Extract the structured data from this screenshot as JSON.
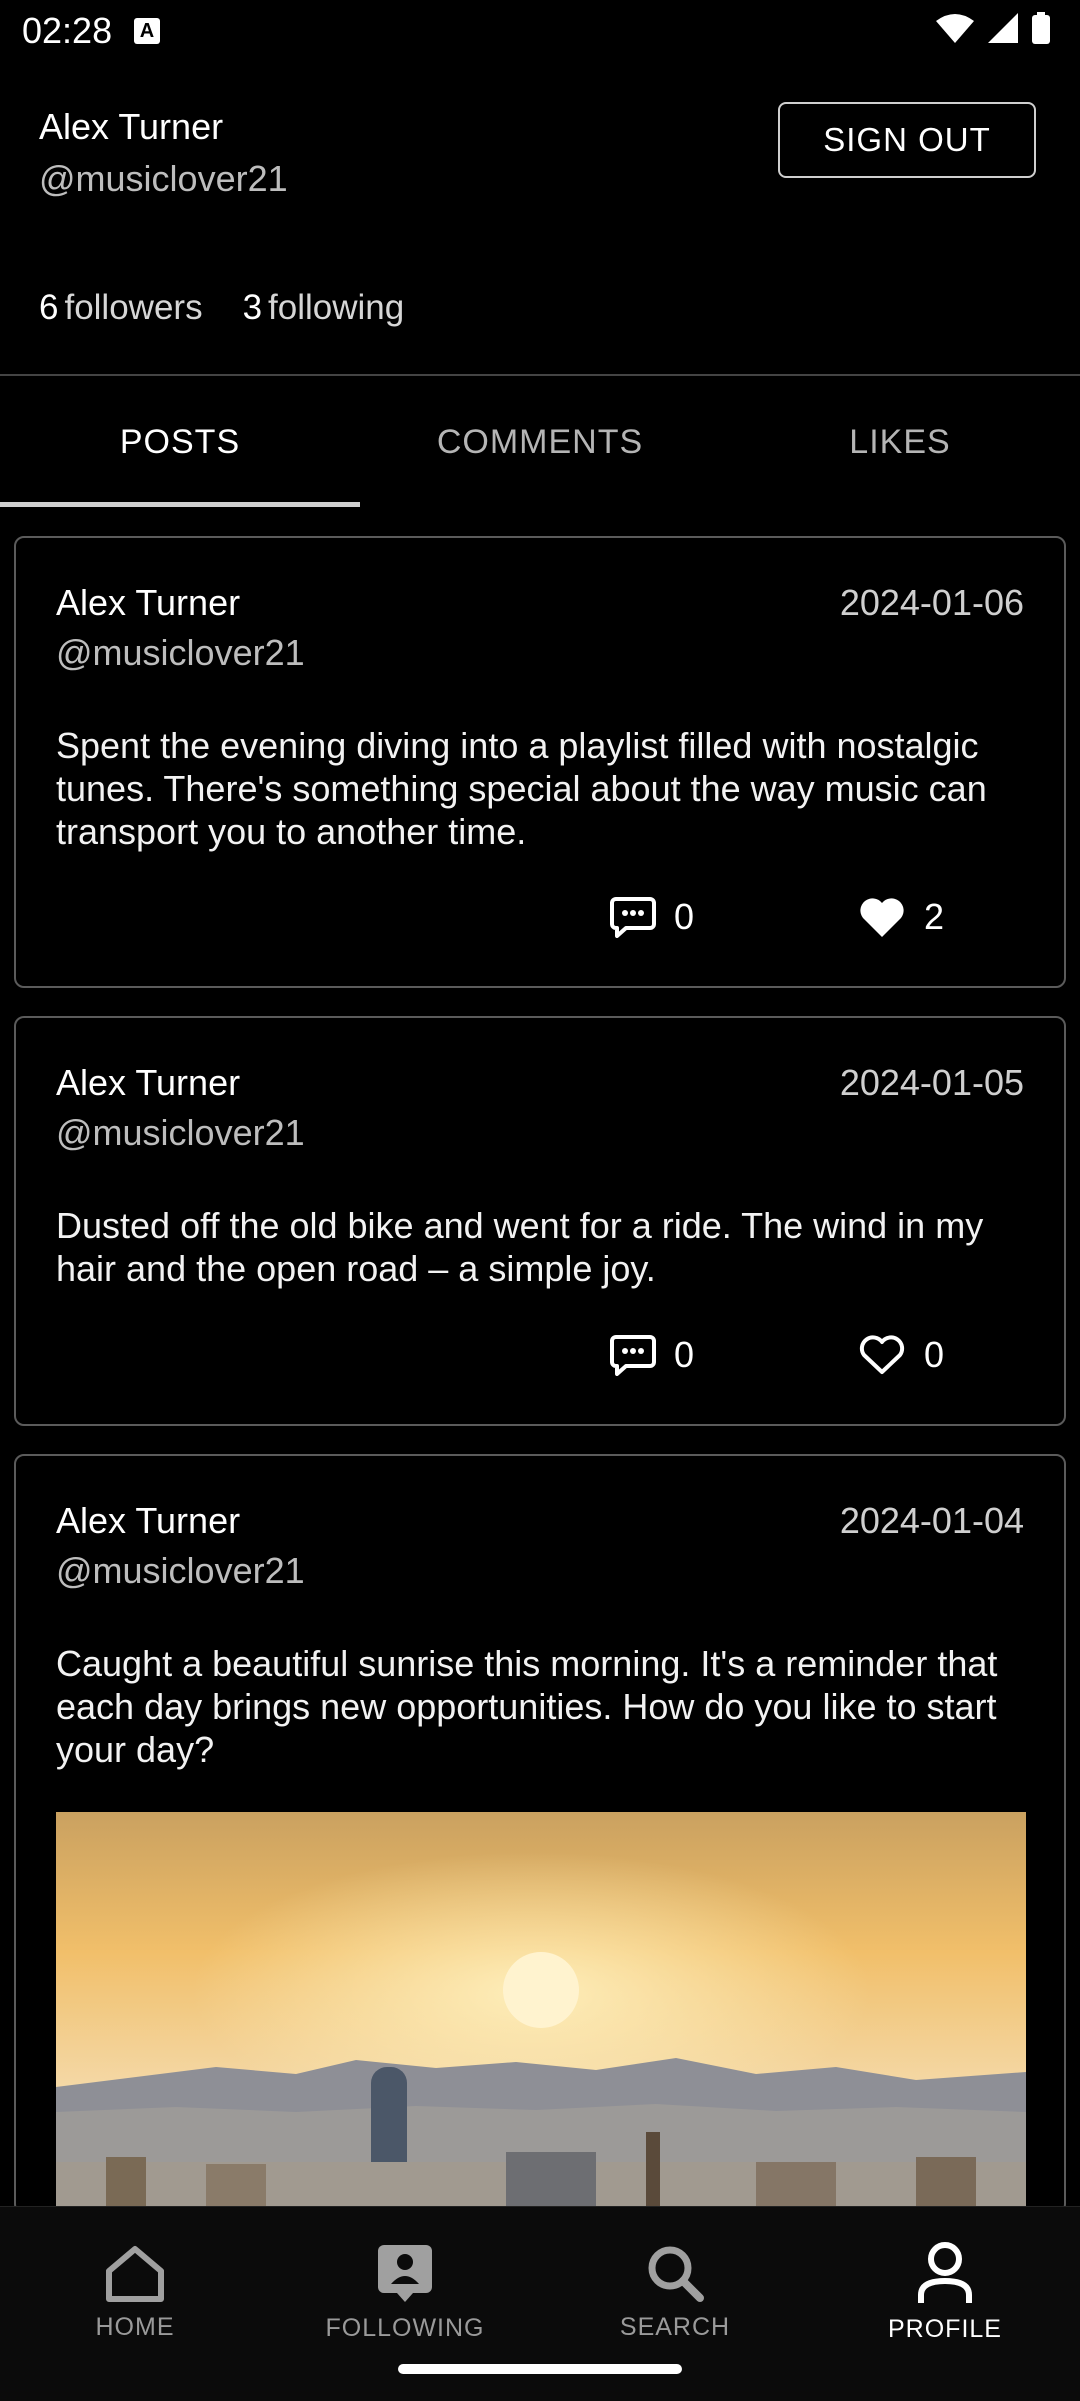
{
  "status": {
    "time": "02:28",
    "colors": {
      "text": "#ffffff",
      "background": "#000000"
    }
  },
  "profile": {
    "name": "Alex Turner",
    "handle": "@musiclover21",
    "signout_label": "SIGN OUT",
    "followers_count": "6",
    "followers_label": "followers",
    "following_count": "3",
    "following_label": "following"
  },
  "tabs": [
    {
      "label": "POSTS",
      "active": true
    },
    {
      "label": "COMMENTS",
      "active": false
    },
    {
      "label": "LIKES",
      "active": false
    }
  ],
  "posts": [
    {
      "author": "Alex Turner",
      "handle": "@musiclover21",
      "date": "2024-01-06",
      "text": "Spent the evening diving into a playlist filled with nostalgic tunes. There's something special about the way music can transport you to another time.",
      "comments": "0",
      "likes": "2",
      "liked": true
    },
    {
      "author": "Alex Turner",
      "handle": "@musiclover21",
      "date": "2024-01-05",
      "text": "Dusted off the old bike and went for a ride. The wind in my hair and the open road – a simple joy.",
      "comments": "0",
      "likes": "0",
      "liked": false
    },
    {
      "author": "Alex Turner",
      "handle": "@musiclover21",
      "date": "2024-01-04",
      "text": "Caught a beautiful sunrise this morning. It's a reminder that each day brings new opportunities. How do you like to start your day?",
      "image": "sunrise-city-photo"
    }
  ],
  "nav": [
    {
      "label": "HOME",
      "icon": "home-icon"
    },
    {
      "label": "FOLLOWING",
      "icon": "following-icon"
    },
    {
      "label": "SEARCH",
      "icon": "search-icon"
    },
    {
      "label": "PROFILE",
      "icon": "profile-icon",
      "active": true
    }
  ]
}
